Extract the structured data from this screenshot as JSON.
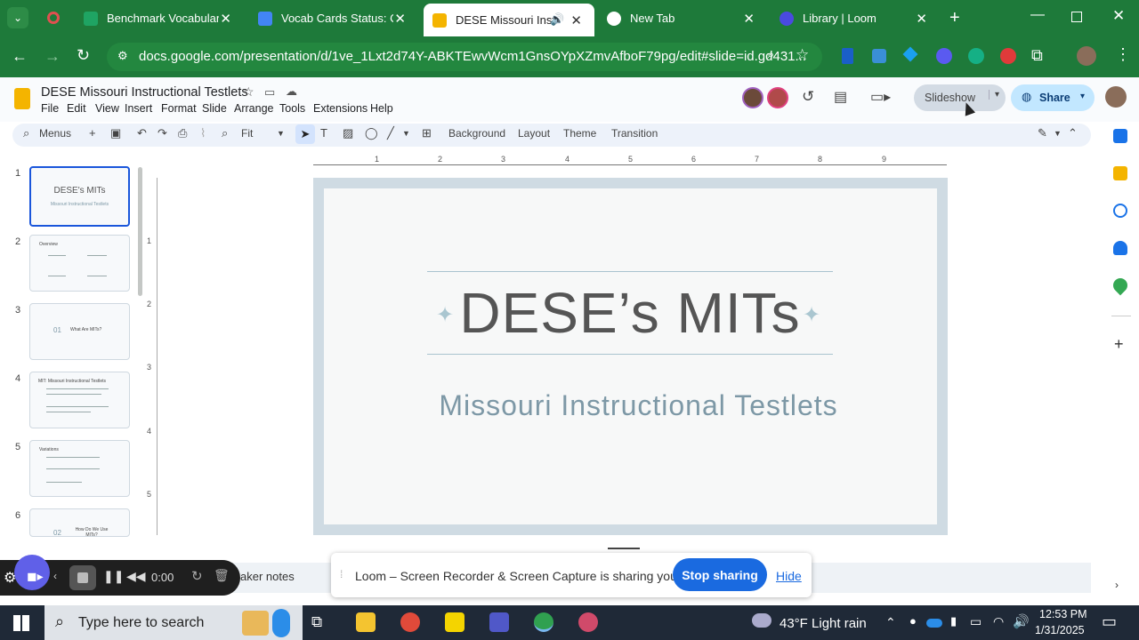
{
  "tabs": [
    {
      "title": "Benchmark Vocabulary",
      "color": "#1fa463"
    },
    {
      "title": "Vocab Cards Status: Co",
      "color": "#4285f4"
    },
    {
      "title": "DESE Missouri Instru",
      "color": "#f4b400"
    },
    {
      "title": "New Tab",
      "color": "#ffffff"
    },
    {
      "title": "Library | Loom",
      "color": "#4a4ae0"
    }
  ],
  "url": "docs.google.com/presentation/d/1ve_1Lxt2d74Y-ABKTEwvWcm1GnsOYpXZmvAfboF79pg/edit#slide=id.gd431...",
  "doc_title": "DESE Missouri Instructional Testlets",
  "menus": [
    "File",
    "Edit",
    "View",
    "Insert",
    "Format",
    "Slide",
    "Arrange",
    "Tools",
    "Extensions",
    "Help"
  ],
  "toolbar": {
    "menus_label": "Menus",
    "zoom": "Fit",
    "background": "Background",
    "layout": "Layout",
    "theme": "Theme",
    "transition": "Transition"
  },
  "header": {
    "slideshow": "Slideshow",
    "share": "Share"
  },
  "ruler_numbers": [
    "1",
    "2",
    "3",
    "4",
    "5",
    "6",
    "7",
    "8",
    "9"
  ],
  "ruler_left": [
    "1",
    "2",
    "3",
    "4",
    "5"
  ],
  "slide_numbers": [
    "1",
    "2",
    "3",
    "4",
    "5",
    "6"
  ],
  "thumbs": {
    "t1_title": "DESE's MITs",
    "t1_sub": "Missouri Instructional Testlets",
    "t2_title": "Overview",
    "t3_num": "01",
    "t3_title": "What Are MITs?",
    "t4_title": "MIT:  Missouri Instructional Testlets",
    "t5_title": "Variations",
    "t6_num": "02",
    "t6_title": "How Do We Use MITs?"
  },
  "slide": {
    "title": "DESE’s MITs",
    "subtitle": "Missouri Instructional Testlets"
  },
  "speaker_notes": "aker notes",
  "loom": {
    "message": "Loom – Screen Recorder & Screen Capture is sharing your screen.",
    "stop": "Stop sharing",
    "hide": "Hide",
    "timer": "0:00"
  },
  "taskbar": {
    "search": "Type here to search",
    "weather": "43°F  Light rain",
    "time": "12:53 PM",
    "date": "1/31/2025"
  }
}
